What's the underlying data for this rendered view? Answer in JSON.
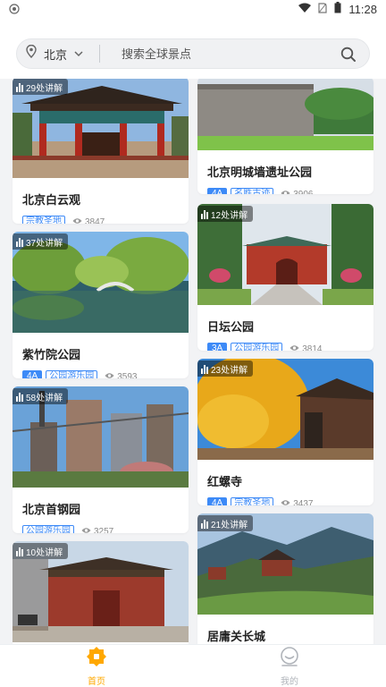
{
  "status_bar": {
    "time": "11:28"
  },
  "search": {
    "city": "北京",
    "placeholder": "搜索全球景点"
  },
  "left_column": [
    {
      "guides": "29处讲解",
      "name": "北京白云观",
      "level": "",
      "type": "宗教圣地",
      "views": "3847"
    },
    {
      "guides": "37处讲解",
      "name": "紫竹院公园",
      "level": "4A",
      "type": "公园游乐园",
      "views": "3593"
    },
    {
      "guides": "58处讲解",
      "name": "北京首钢园",
      "level": "",
      "type": "公园游乐园",
      "views": "3257"
    },
    {
      "guides": "10处讲解",
      "name": "",
      "level": "",
      "type": "",
      "views": ""
    }
  ],
  "right_column": [
    {
      "guides": "",
      "name": "北京明城墙遗址公园",
      "level": "4A",
      "type": "名胜古迹",
      "views": "3906"
    },
    {
      "guides": "12处讲解",
      "name": "日坛公园",
      "level": "3A",
      "type": "公园游乐园",
      "views": "3814"
    },
    {
      "guides": "23处讲解",
      "name": "红螺寺",
      "level": "4A",
      "type": "宗教圣地",
      "views": "3437"
    },
    {
      "guides": "21处讲解",
      "name": "居庸关长城",
      "level": "",
      "type": "",
      "views": ""
    }
  ],
  "tab_bar": {
    "home_label": "首页",
    "me_label": "我的"
  },
  "colors": {
    "accent": "#3d8af7",
    "tab_active": "#ffa800"
  }
}
